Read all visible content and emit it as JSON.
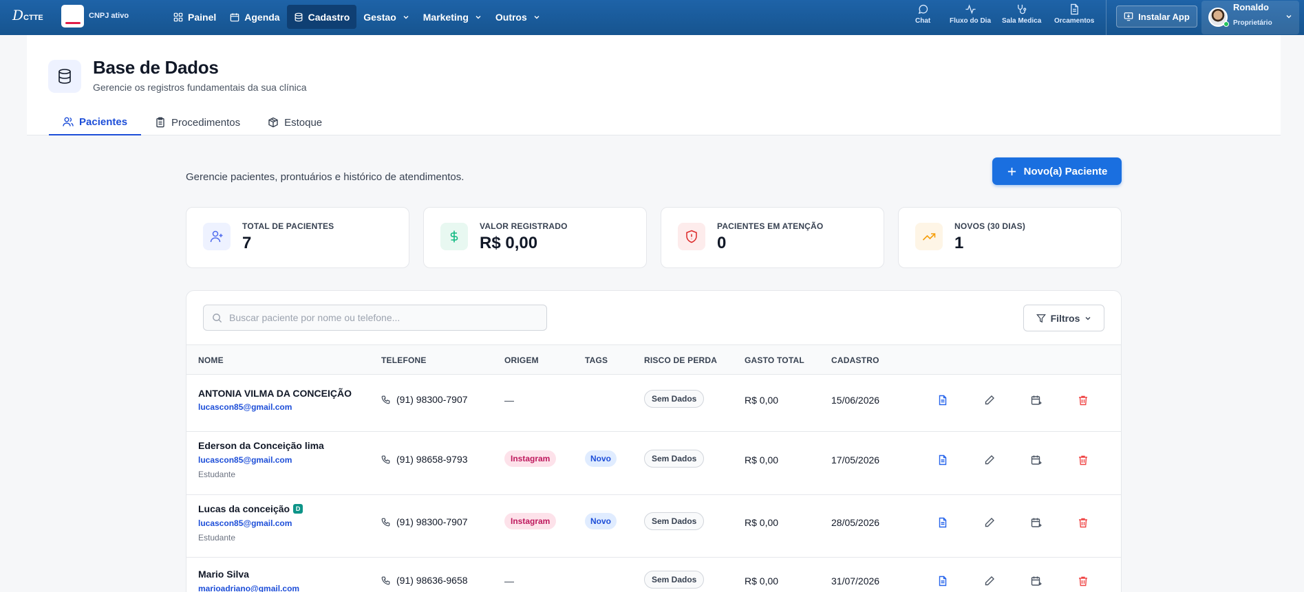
{
  "topbar": {
    "logo_main": "D",
    "logo_sub": "CTTE",
    "cnpj_status": "CNPJ ativo",
    "nav": [
      {
        "label": "Painel",
        "icon": "grid-icon",
        "active": false
      },
      {
        "label": "Agenda",
        "icon": "calendar-icon",
        "active": false
      },
      {
        "label": "Cadastro",
        "icon": "database-icon",
        "active": true
      },
      {
        "label": "Gestao",
        "icon": "",
        "dropdown": true
      },
      {
        "label": "Marketing",
        "icon": "",
        "dropdown": true
      },
      {
        "label": "Outros",
        "icon": "",
        "dropdown": true
      }
    ],
    "quick_links": [
      {
        "label": "Chat",
        "icon": "chat-icon"
      },
      {
        "label": "Fluxo do Dia",
        "icon": "activity-icon"
      },
      {
        "label": "Sala Medica",
        "icon": "stethoscope-icon"
      },
      {
        "label": "Orcamentos",
        "icon": "document-icon"
      }
    ],
    "install_label": "Instalar App",
    "user": {
      "name": "Ronaldo",
      "role": "Proprietário"
    }
  },
  "header": {
    "title": "Base de Dados",
    "subtitle": "Gerencie os registros fundamentais da sua clínica",
    "tabs": [
      {
        "label": "Pacientes",
        "icon": "users-icon",
        "active": true
      },
      {
        "label": "Procedimentos",
        "icon": "clipboard-icon",
        "active": false
      },
      {
        "label": "Estoque",
        "icon": "box-icon",
        "active": false
      }
    ]
  },
  "content": {
    "intro": "Gerencie pacientes, prontuários e histórico de atendimentos.",
    "new_button": "Novo(a) Paciente",
    "stats": [
      {
        "label": "TOTAL DE PACIENTES",
        "value": "7",
        "icon": "user-plus-icon",
        "color": "#4f6bed",
        "bg": "#eef2ff"
      },
      {
        "label": "VALOR REGISTRADO",
        "value": "R$ 0,00",
        "icon": "dollar-icon",
        "color": "#10b981",
        "bg": "#e8f8f1"
      },
      {
        "label": "PACIENTES EM ATENÇÃO",
        "value": "0",
        "icon": "shield-alert-icon",
        "color": "#dc2626",
        "bg": "#fdecec"
      },
      {
        "label": "NOVOS (30 DIAS)",
        "value": "1",
        "icon": "trending-up-icon",
        "color": "#f59e0b",
        "bg": "#fef5e6"
      }
    ],
    "search_placeholder": "Buscar paciente por nome ou telefone...",
    "filter_label": "Filtros",
    "columns": [
      "NOME",
      "TELEFONE",
      "ORIGEM",
      "TAGS",
      "RISCO DE PERDA",
      "GASTO TOTAL",
      "CADASTRO"
    ],
    "rows": [
      {
        "name": "ANTONIA VILMA DA CONCEIÇÃO",
        "email": "lucascon85@gmail.com",
        "job": "",
        "badge": "",
        "phone": "(91) 98300-7907",
        "origin": "—",
        "tag": "",
        "risk": "Sem Dados",
        "total": "R$ 0,00",
        "date": "15/06/2026"
      },
      {
        "name": "Ederson da Conceição lima",
        "email": "lucascon85@gmail.com",
        "job": "Estudante",
        "badge": "",
        "phone": "(91) 98658-9793",
        "origin": "Instagram",
        "tag": "Novo",
        "risk": "Sem Dados",
        "total": "R$ 0,00",
        "date": "17/05/2026"
      },
      {
        "name": "Lucas da conceição",
        "email": "lucascon85@gmail.com",
        "job": "Estudante",
        "badge": "D",
        "phone": "(91) 98300-7907",
        "origin": "Instagram",
        "tag": "Novo",
        "risk": "Sem Dados",
        "total": "R$ 0,00",
        "date": "28/05/2026"
      },
      {
        "name": "Mario Silva",
        "email": "marioadriano@gmail.com",
        "job": "",
        "badge": "",
        "phone": "(91) 98636-9658",
        "origin": "—",
        "tag": "",
        "risk": "Sem Dados",
        "total": "R$ 0,00",
        "date": "31/07/2026"
      }
    ]
  }
}
